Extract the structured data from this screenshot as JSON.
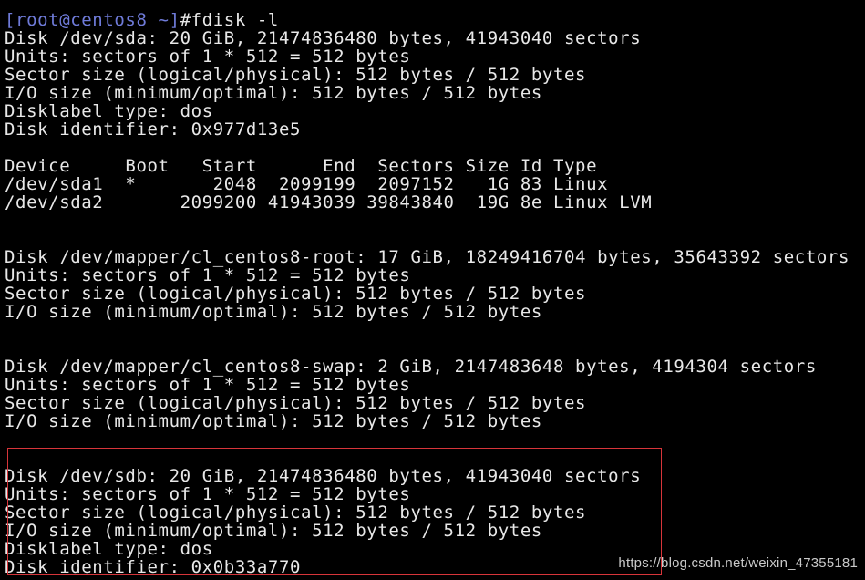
{
  "terminal": {
    "prompt_user": "[root@centos8 ~]",
    "prompt_cmd": "#fdisk -l",
    "lines": [
      "Disk /dev/sda: 20 GiB, 21474836480 bytes, 41943040 sectors",
      "Units: sectors of 1 * 512 = 512 bytes",
      "Sector size (logical/physical): 512 bytes / 512 bytes",
      "I/O size (minimum/optimal): 512 bytes / 512 bytes",
      "Disklabel type: dos",
      "Disk identifier: 0x977d13e5",
      "",
      "Device     Boot   Start      End  Sectors Size Id Type",
      "/dev/sda1  *       2048  2099199  2097152   1G 83 Linux",
      "/dev/sda2       2099200 41943039 39843840  19G 8e Linux LVM",
      "",
      "",
      "Disk /dev/mapper/cl_centos8-root: 17 GiB, 18249416704 bytes, 35643392 sectors",
      "Units: sectors of 1 * 512 = 512 bytes",
      "Sector size (logical/physical): 512 bytes / 512 bytes",
      "I/O size (minimum/optimal): 512 bytes / 512 bytes",
      "",
      "",
      "Disk /dev/mapper/cl_centos8-swap: 2 GiB, 2147483648 bytes, 4194304 sectors",
      "Units: sectors of 1 * 512 = 512 bytes",
      "Sector size (logical/physical): 512 bytes / 512 bytes",
      "I/O size (minimum/optimal): 512 bytes / 512 bytes",
      "",
      "",
      "Disk /dev/sdb: 20 GiB, 21474836480 bytes, 41943040 sectors",
      "Units: sectors of 1 * 512 = 512 bytes",
      "Sector size (logical/physical): 512 bytes / 512 bytes",
      "I/O size (minimum/optimal): 512 bytes / 512 bytes",
      "Disklabel type: dos",
      "Disk identifier: 0x0b33a770"
    ]
  },
  "watermark": "https://blog.csdn.net/weixin_47355181",
  "colors": {
    "background": "#000000",
    "text": "#e8e8e8",
    "prompt": "#6f7bd9",
    "highlight_border": "#d7353a"
  }
}
